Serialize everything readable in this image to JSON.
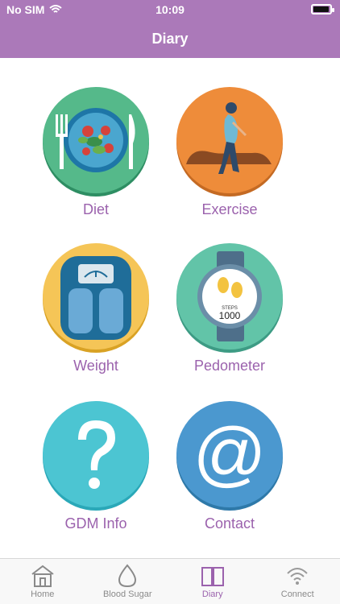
{
  "status": {
    "carrier": "No SIM",
    "time": "10:09"
  },
  "header": {
    "title": "Diary"
  },
  "tiles": [
    {
      "label": "Diet"
    },
    {
      "label": "Exercise"
    },
    {
      "label": "Weight"
    },
    {
      "label": "Pedometer",
      "steps_caption": "STEPS",
      "steps_value": "1000"
    },
    {
      "label": "GDM Info"
    },
    {
      "label": "Contact"
    }
  ],
  "tabbar": [
    {
      "label": "Home",
      "icon": "home-icon"
    },
    {
      "label": "Blood Sugar",
      "icon": "drop-icon"
    },
    {
      "label": "Diary",
      "icon": "book-icon",
      "active": true
    },
    {
      "label": "Connect",
      "icon": "wifi-icon"
    }
  ],
  "colors": {
    "accent": "#9b62ad",
    "header": "#ab79b9"
  }
}
